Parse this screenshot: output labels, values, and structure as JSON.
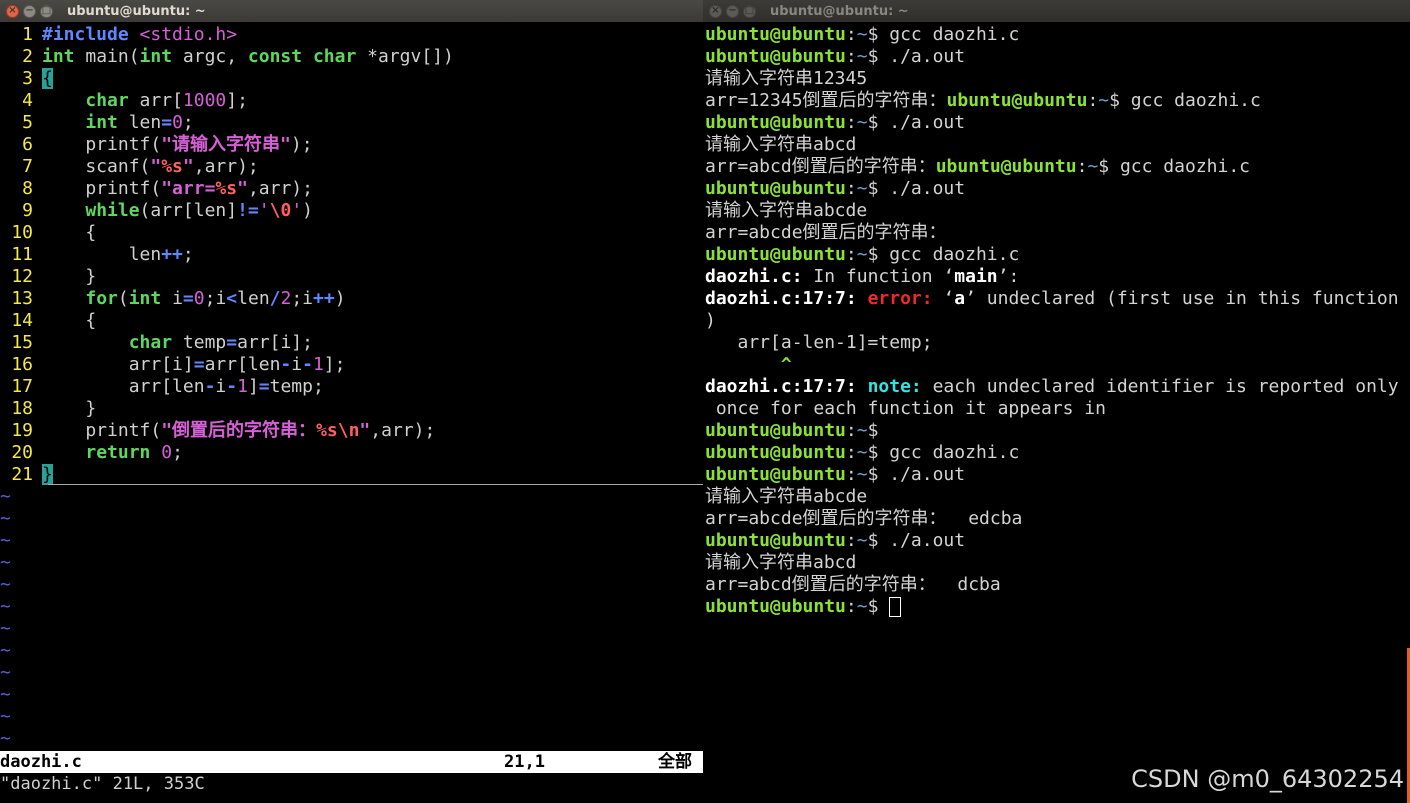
{
  "left_window": {
    "title": "ubuntu@ubuntu: ~",
    "code": [
      {
        "n": "1",
        "parts": [
          [
            "#include ",
            "#5f87ff"
          ],
          [
            "<stdio.h>",
            "#d75fd7"
          ]
        ]
      },
      {
        "n": "2",
        "parts": [
          [
            "int",
            "#5fd75f"
          ],
          [
            " main(",
            "#d0d0d0"
          ],
          [
            "int",
            "#5fd75f"
          ],
          [
            " argc, ",
            "#d0d0d0"
          ],
          [
            "const",
            "#5fd75f"
          ],
          [
            " ",
            "#d0d0d0"
          ],
          [
            "char",
            "#5fd75f"
          ],
          [
            " *argv[])",
            "#d0d0d0"
          ]
        ]
      },
      {
        "n": "3",
        "parts": [
          [
            "{",
            "#d0d0d0"
          ]
        ],
        "cursor": true
      },
      {
        "n": "4",
        "parts": [
          [
            "    ",
            "#d0d0d0"
          ],
          [
            "char",
            "#5fd75f"
          ],
          [
            " arr[",
            "#d0d0d0"
          ],
          [
            "1000",
            "#d75fd7"
          ],
          [
            "];",
            "#d0d0d0"
          ]
        ]
      },
      {
        "n": "5",
        "parts": [
          [
            "    ",
            "#d0d0d0"
          ],
          [
            "int",
            "#5fd75f"
          ],
          [
            " len",
            "#d0d0d0"
          ],
          [
            "=",
            "#5f87ff"
          ],
          [
            "0",
            "#d75fd7"
          ],
          [
            ";",
            "#d0d0d0"
          ]
        ]
      },
      {
        "n": "6",
        "parts": [
          [
            "    printf(",
            "#d0d0d0"
          ],
          [
            "\"请输入字符串\"",
            "#d75fd7"
          ],
          [
            ");",
            "#d0d0d0"
          ]
        ]
      },
      {
        "n": "7",
        "parts": [
          [
            "    scanf(",
            "#d0d0d0"
          ],
          [
            "\"",
            "#d75fd7"
          ],
          [
            "%s",
            "#ff5f5f"
          ],
          [
            "\"",
            "#d75fd7"
          ],
          [
            ",arr);",
            "#d0d0d0"
          ]
        ]
      },
      {
        "n": "8",
        "parts": [
          [
            "    printf(",
            "#d0d0d0"
          ],
          [
            "\"arr=",
            "#d75fd7"
          ],
          [
            "%s",
            "#ff5f5f"
          ],
          [
            "\"",
            "#d75fd7"
          ],
          [
            ",arr);",
            "#d0d0d0"
          ]
        ]
      },
      {
        "n": "9",
        "parts": [
          [
            "    ",
            "#d0d0d0"
          ],
          [
            "while",
            "#5fd75f"
          ],
          [
            "(arr[len]",
            "#d0d0d0"
          ],
          [
            "!=",
            "#5f87ff"
          ],
          [
            "'",
            "#d75fd7"
          ],
          [
            "\\0",
            "#ff5f5f"
          ],
          [
            "'",
            "#d75fd7"
          ],
          [
            ")",
            "#d0d0d0"
          ]
        ]
      },
      {
        "n": "10",
        "parts": [
          [
            "    {",
            "#d0d0d0"
          ]
        ]
      },
      {
        "n": "11",
        "parts": [
          [
            "        len",
            "#d0d0d0"
          ],
          [
            "++",
            "#5f87ff"
          ],
          [
            ";",
            "#d0d0d0"
          ]
        ]
      },
      {
        "n": "12",
        "parts": [
          [
            "    }",
            "#d0d0d0"
          ]
        ]
      },
      {
        "n": "13",
        "parts": [
          [
            "    ",
            "#d0d0d0"
          ],
          [
            "for",
            "#5fd75f"
          ],
          [
            "(",
            "#d0d0d0"
          ],
          [
            "int",
            "#5fd75f"
          ],
          [
            " i",
            "#d0d0d0"
          ],
          [
            "=",
            "#5f87ff"
          ],
          [
            "0",
            "#d75fd7"
          ],
          [
            ";i",
            "#d0d0d0"
          ],
          [
            "<",
            "#5f87ff"
          ],
          [
            "len",
            "#d0d0d0"
          ],
          [
            "/",
            "#5f87ff"
          ],
          [
            "2",
            "#d75fd7"
          ],
          [
            ";i",
            "#d0d0d0"
          ],
          [
            "++",
            "#5f87ff"
          ],
          [
            ")",
            "#d0d0d0"
          ]
        ]
      },
      {
        "n": "14",
        "parts": [
          [
            "    {",
            "#d0d0d0"
          ]
        ]
      },
      {
        "n": "15",
        "parts": [
          [
            "        ",
            "#d0d0d0"
          ],
          [
            "char",
            "#5fd75f"
          ],
          [
            " temp",
            "#d0d0d0"
          ],
          [
            "=",
            "#5f87ff"
          ],
          [
            "arr[i];",
            "#d0d0d0"
          ]
        ]
      },
      {
        "n": "16",
        "parts": [
          [
            "        arr[i]",
            "#d0d0d0"
          ],
          [
            "=",
            "#5f87ff"
          ],
          [
            "arr[len",
            "#d0d0d0"
          ],
          [
            "-",
            "#5f87ff"
          ],
          [
            "i",
            "#d0d0d0"
          ],
          [
            "-",
            "#5f87ff"
          ],
          [
            "1",
            "#d75fd7"
          ],
          [
            "];",
            "#d0d0d0"
          ]
        ]
      },
      {
        "n": "17",
        "parts": [
          [
            "        arr[len",
            "#d0d0d0"
          ],
          [
            "-",
            "#5f87ff"
          ],
          [
            "i",
            "#d0d0d0"
          ],
          [
            "-",
            "#5f87ff"
          ],
          [
            "1",
            "#d75fd7"
          ],
          [
            "]",
            "#d0d0d0"
          ],
          [
            "=",
            "#5f87ff"
          ],
          [
            "temp;",
            "#d0d0d0"
          ]
        ]
      },
      {
        "n": "18",
        "parts": [
          [
            "    }",
            "#d0d0d0"
          ]
        ]
      },
      {
        "n": "19",
        "parts": [
          [
            "    printf(",
            "#d0d0d0"
          ],
          [
            "\"倒置后的字符串：",
            "#d75fd7"
          ],
          [
            "%s\\n",
            "#ff5f5f"
          ],
          [
            "\"",
            "#d75fd7"
          ],
          [
            ",arr);",
            "#d0d0d0"
          ]
        ]
      },
      {
        "n": "20",
        "parts": [
          [
            "    ",
            "#d0d0d0"
          ],
          [
            "return",
            "#5fd75f"
          ],
          [
            " ",
            "#d0d0d0"
          ],
          [
            "0",
            "#d75fd7"
          ],
          [
            ";",
            "#d0d0d0"
          ]
        ]
      },
      {
        "n": "21",
        "parts": [
          [
            "}",
            "#d0d0d0"
          ]
        ],
        "cursor": true
      }
    ],
    "tilde_count": 12,
    "tilde": "~",
    "status_file": "daozhi.c",
    "status_pos": "21,1",
    "status_all": "全部",
    "message": "\"daozhi.c\" 21L, 353C"
  },
  "right_window": {
    "title": "ubuntu@ubuntu: ~",
    "lines": [
      [
        [
          "ubuntu@ubuntu",
          "pg"
        ],
        [
          ":",
          "t"
        ],
        [
          "~",
          "pb"
        ],
        [
          "$ gcc daozhi.c",
          "t"
        ]
      ],
      [
        [
          "ubuntu@ubuntu",
          "pg"
        ],
        [
          ":",
          "t"
        ],
        [
          "~",
          "pb"
        ],
        [
          "$ ./a.out",
          "t"
        ]
      ],
      [
        [
          "请输入字符串12345",
          "t"
        ]
      ],
      [
        [
          "arr=12345倒置后的字符串：",
          "t"
        ],
        [
          "ubuntu@ubuntu",
          "pg"
        ],
        [
          ":",
          "t"
        ],
        [
          "~",
          "pb"
        ],
        [
          "$ gcc daozhi.c",
          "t"
        ]
      ],
      [
        [
          "ubuntu@ubuntu",
          "pg"
        ],
        [
          ":",
          "t"
        ],
        [
          "~",
          "pb"
        ],
        [
          "$ ./a.out",
          "t"
        ]
      ],
      [
        [
          "请输入字符串abcd",
          "t"
        ]
      ],
      [
        [
          "arr=abcd倒置后的字符串：",
          "t"
        ],
        [
          "ubuntu@ubuntu",
          "pg"
        ],
        [
          ":",
          "t"
        ],
        [
          "~",
          "pb"
        ],
        [
          "$ gcc daozhi.c",
          "t"
        ]
      ],
      [
        [
          "ubuntu@ubuntu",
          "pg"
        ],
        [
          ":",
          "t"
        ],
        [
          "~",
          "pb"
        ],
        [
          "$ ./a.out",
          "t"
        ]
      ],
      [
        [
          "请输入字符串abcde",
          "t"
        ]
      ],
      [
        [
          "arr=abcde倒置后的字符串：",
          "t"
        ]
      ],
      [
        [
          "ubuntu@ubuntu",
          "pg"
        ],
        [
          ":",
          "t"
        ],
        [
          "~",
          "pb"
        ],
        [
          "$ gcc daozhi.c",
          "t"
        ]
      ],
      [
        [
          "daozhi.c:",
          "wh"
        ],
        [
          " In function ‘",
          "t"
        ],
        [
          "main",
          "wh"
        ],
        [
          "’:",
          "t"
        ]
      ],
      [
        [
          "daozhi.c:17:7:",
          "wh"
        ],
        [
          " ",
          "t"
        ],
        [
          "error:",
          "er"
        ],
        [
          " ‘",
          "t"
        ],
        [
          "a",
          "wh"
        ],
        [
          "’ undeclared (first use in this function",
          "t"
        ]
      ],
      [
        [
          ")",
          "t"
        ]
      ],
      [
        [
          "   arr[a-len-1]=temp;",
          "t"
        ]
      ],
      [
        [
          "       ^",
          "pg"
        ]
      ],
      [
        [
          "daozhi.c:17:7:",
          "wh"
        ],
        [
          " ",
          "t"
        ],
        [
          "note:",
          "nt"
        ],
        [
          " each undeclared identifier is reported only",
          "t"
        ]
      ],
      [
        [
          " once for each function it appears in",
          "t"
        ]
      ],
      [
        [
          "ubuntu@ubuntu",
          "pg"
        ],
        [
          ":",
          "t"
        ],
        [
          "~",
          "pb"
        ],
        [
          "$",
          "t"
        ]
      ],
      [
        [
          "ubuntu@ubuntu",
          "pg"
        ],
        [
          ":",
          "t"
        ],
        [
          "~",
          "pb"
        ],
        [
          "$ gcc daozhi.c",
          "t"
        ]
      ],
      [
        [
          "ubuntu@ubuntu",
          "pg"
        ],
        [
          ":",
          "t"
        ],
        [
          "~",
          "pb"
        ],
        [
          "$ ./a.out",
          "t"
        ]
      ],
      [
        [
          "请输入字符串abcde",
          "t"
        ]
      ],
      [
        [
          "arr=abcde倒置后的字符串：  edcba",
          "t"
        ]
      ],
      [
        [
          "ubuntu@ubuntu",
          "pg"
        ],
        [
          ":",
          "t"
        ],
        [
          "~",
          "pb"
        ],
        [
          "$ ./a.out",
          "t"
        ]
      ],
      [
        [
          "请输入字符串abcd",
          "t"
        ]
      ],
      [
        [
          "arr=abcd倒置后的字符串：  dcba",
          "t"
        ]
      ],
      [
        [
          "ubuntu@ubuntu",
          "pg"
        ],
        [
          ":",
          "t"
        ],
        [
          "~",
          "pb"
        ],
        [
          "$ ",
          "t"
        ]
      ]
    ]
  },
  "watermark": "CSDN @m0_64302254"
}
